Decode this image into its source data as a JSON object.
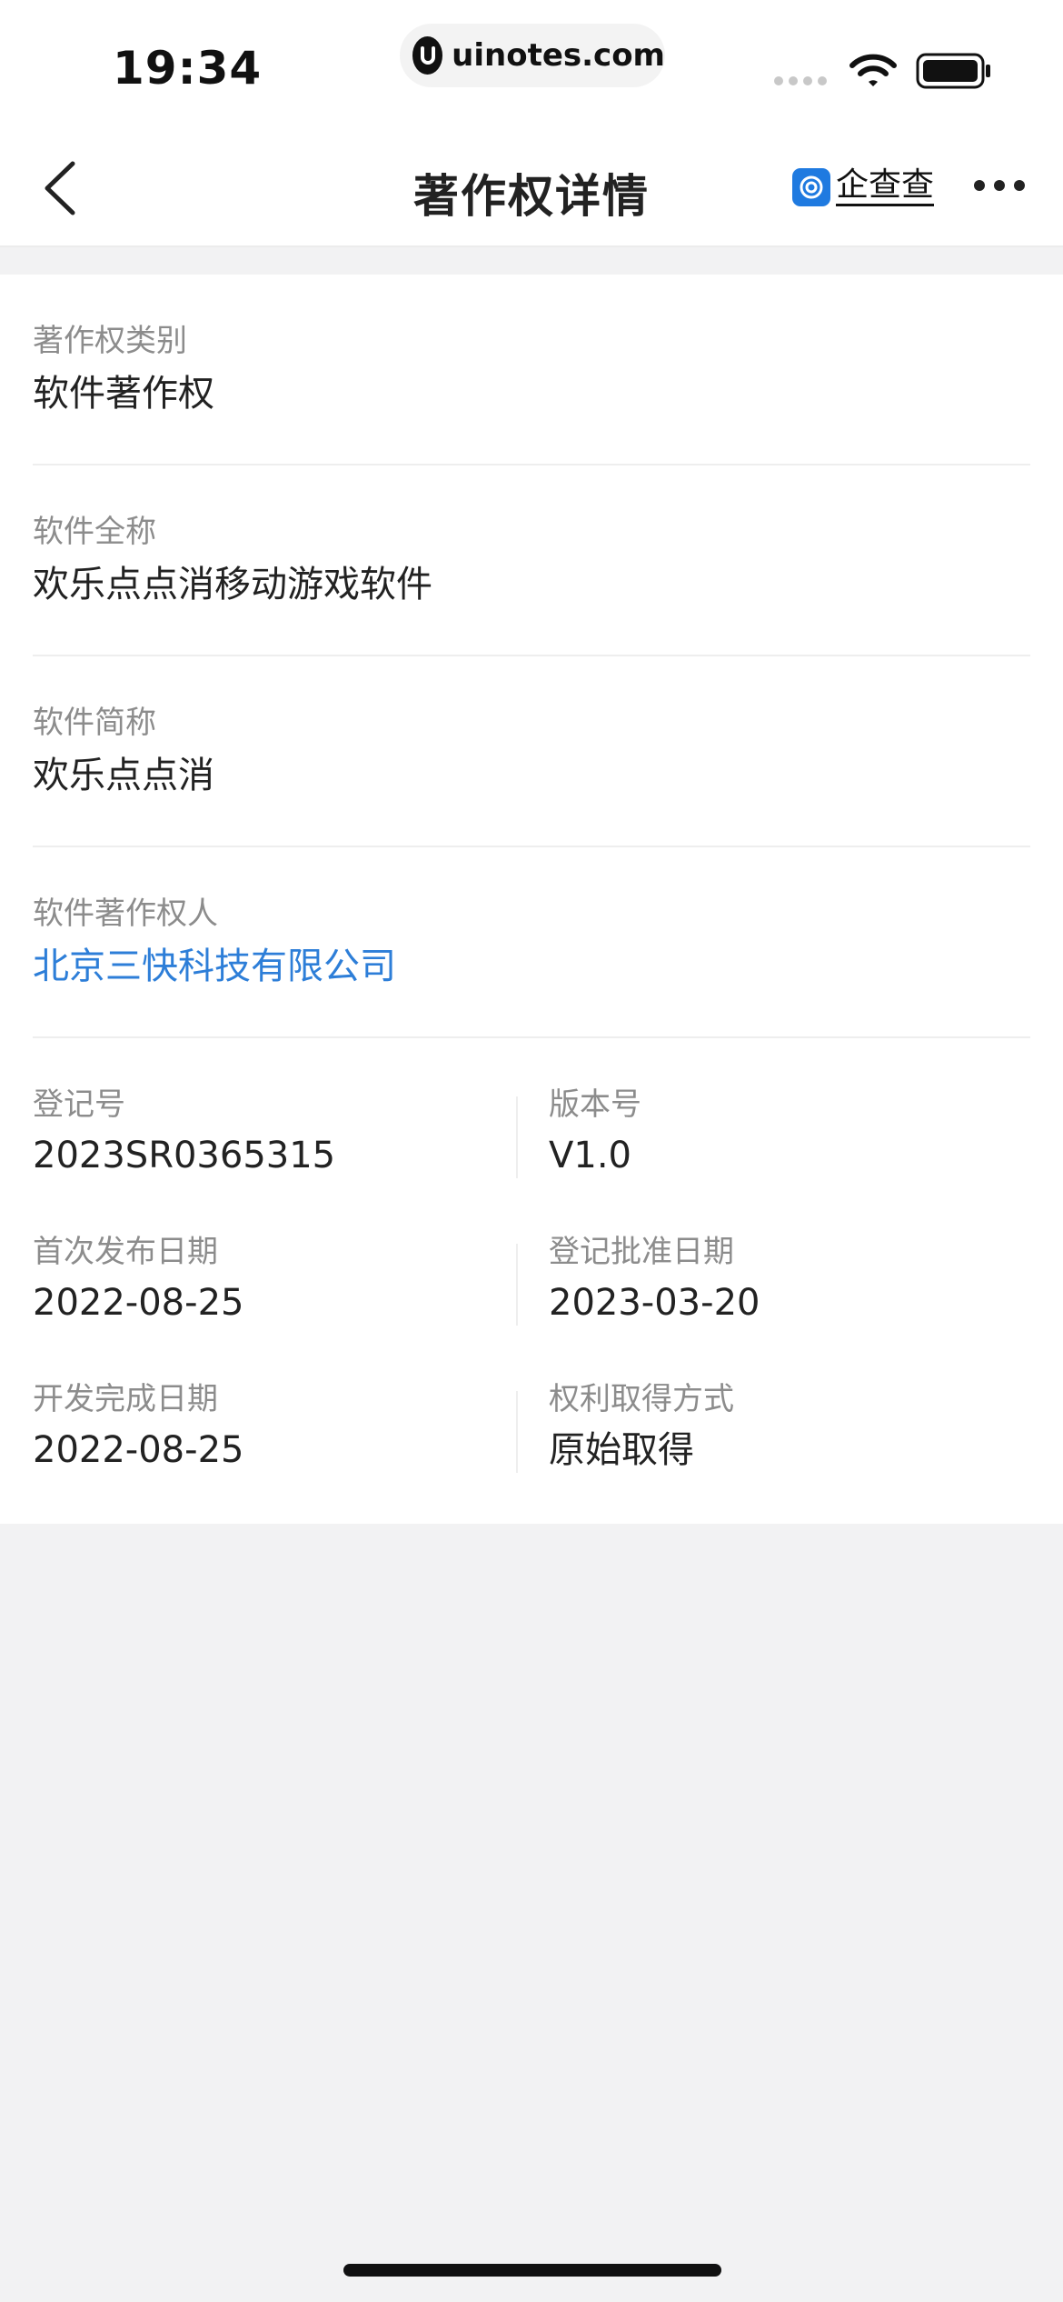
{
  "status_bar": {
    "time": "19:34",
    "url": "uinotes.com"
  },
  "header": {
    "title": "著作权详情",
    "brand": "企查查"
  },
  "details": {
    "category": {
      "label": "著作权类别",
      "value": "软件著作权"
    },
    "full_name": {
      "label": "软件全称",
      "value": "欢乐点点消移动游戏软件"
    },
    "short_name": {
      "label": "软件简称",
      "value": "欢乐点点消"
    },
    "owner": {
      "label": "软件著作权人",
      "value": "北京三快科技有限公司"
    }
  },
  "grid": [
    {
      "left": {
        "label": "登记号",
        "value": "2023SR0365315"
      },
      "right": {
        "label": "版本号",
        "value": "V1.0"
      }
    },
    {
      "left": {
        "label": "首次发布日期",
        "value": "2022-08-25"
      },
      "right": {
        "label": "登记批准日期",
        "value": "2023-03-20"
      }
    },
    {
      "left": {
        "label": "开发完成日期",
        "value": "2022-08-25"
      },
      "right": {
        "label": "权利取得方式",
        "value": "原始取得"
      }
    }
  ],
  "colors": {
    "link": "#2d7ed8",
    "brand": "#1f7ae0",
    "label": "#8c8c8c",
    "background": "#f2f2f3"
  }
}
